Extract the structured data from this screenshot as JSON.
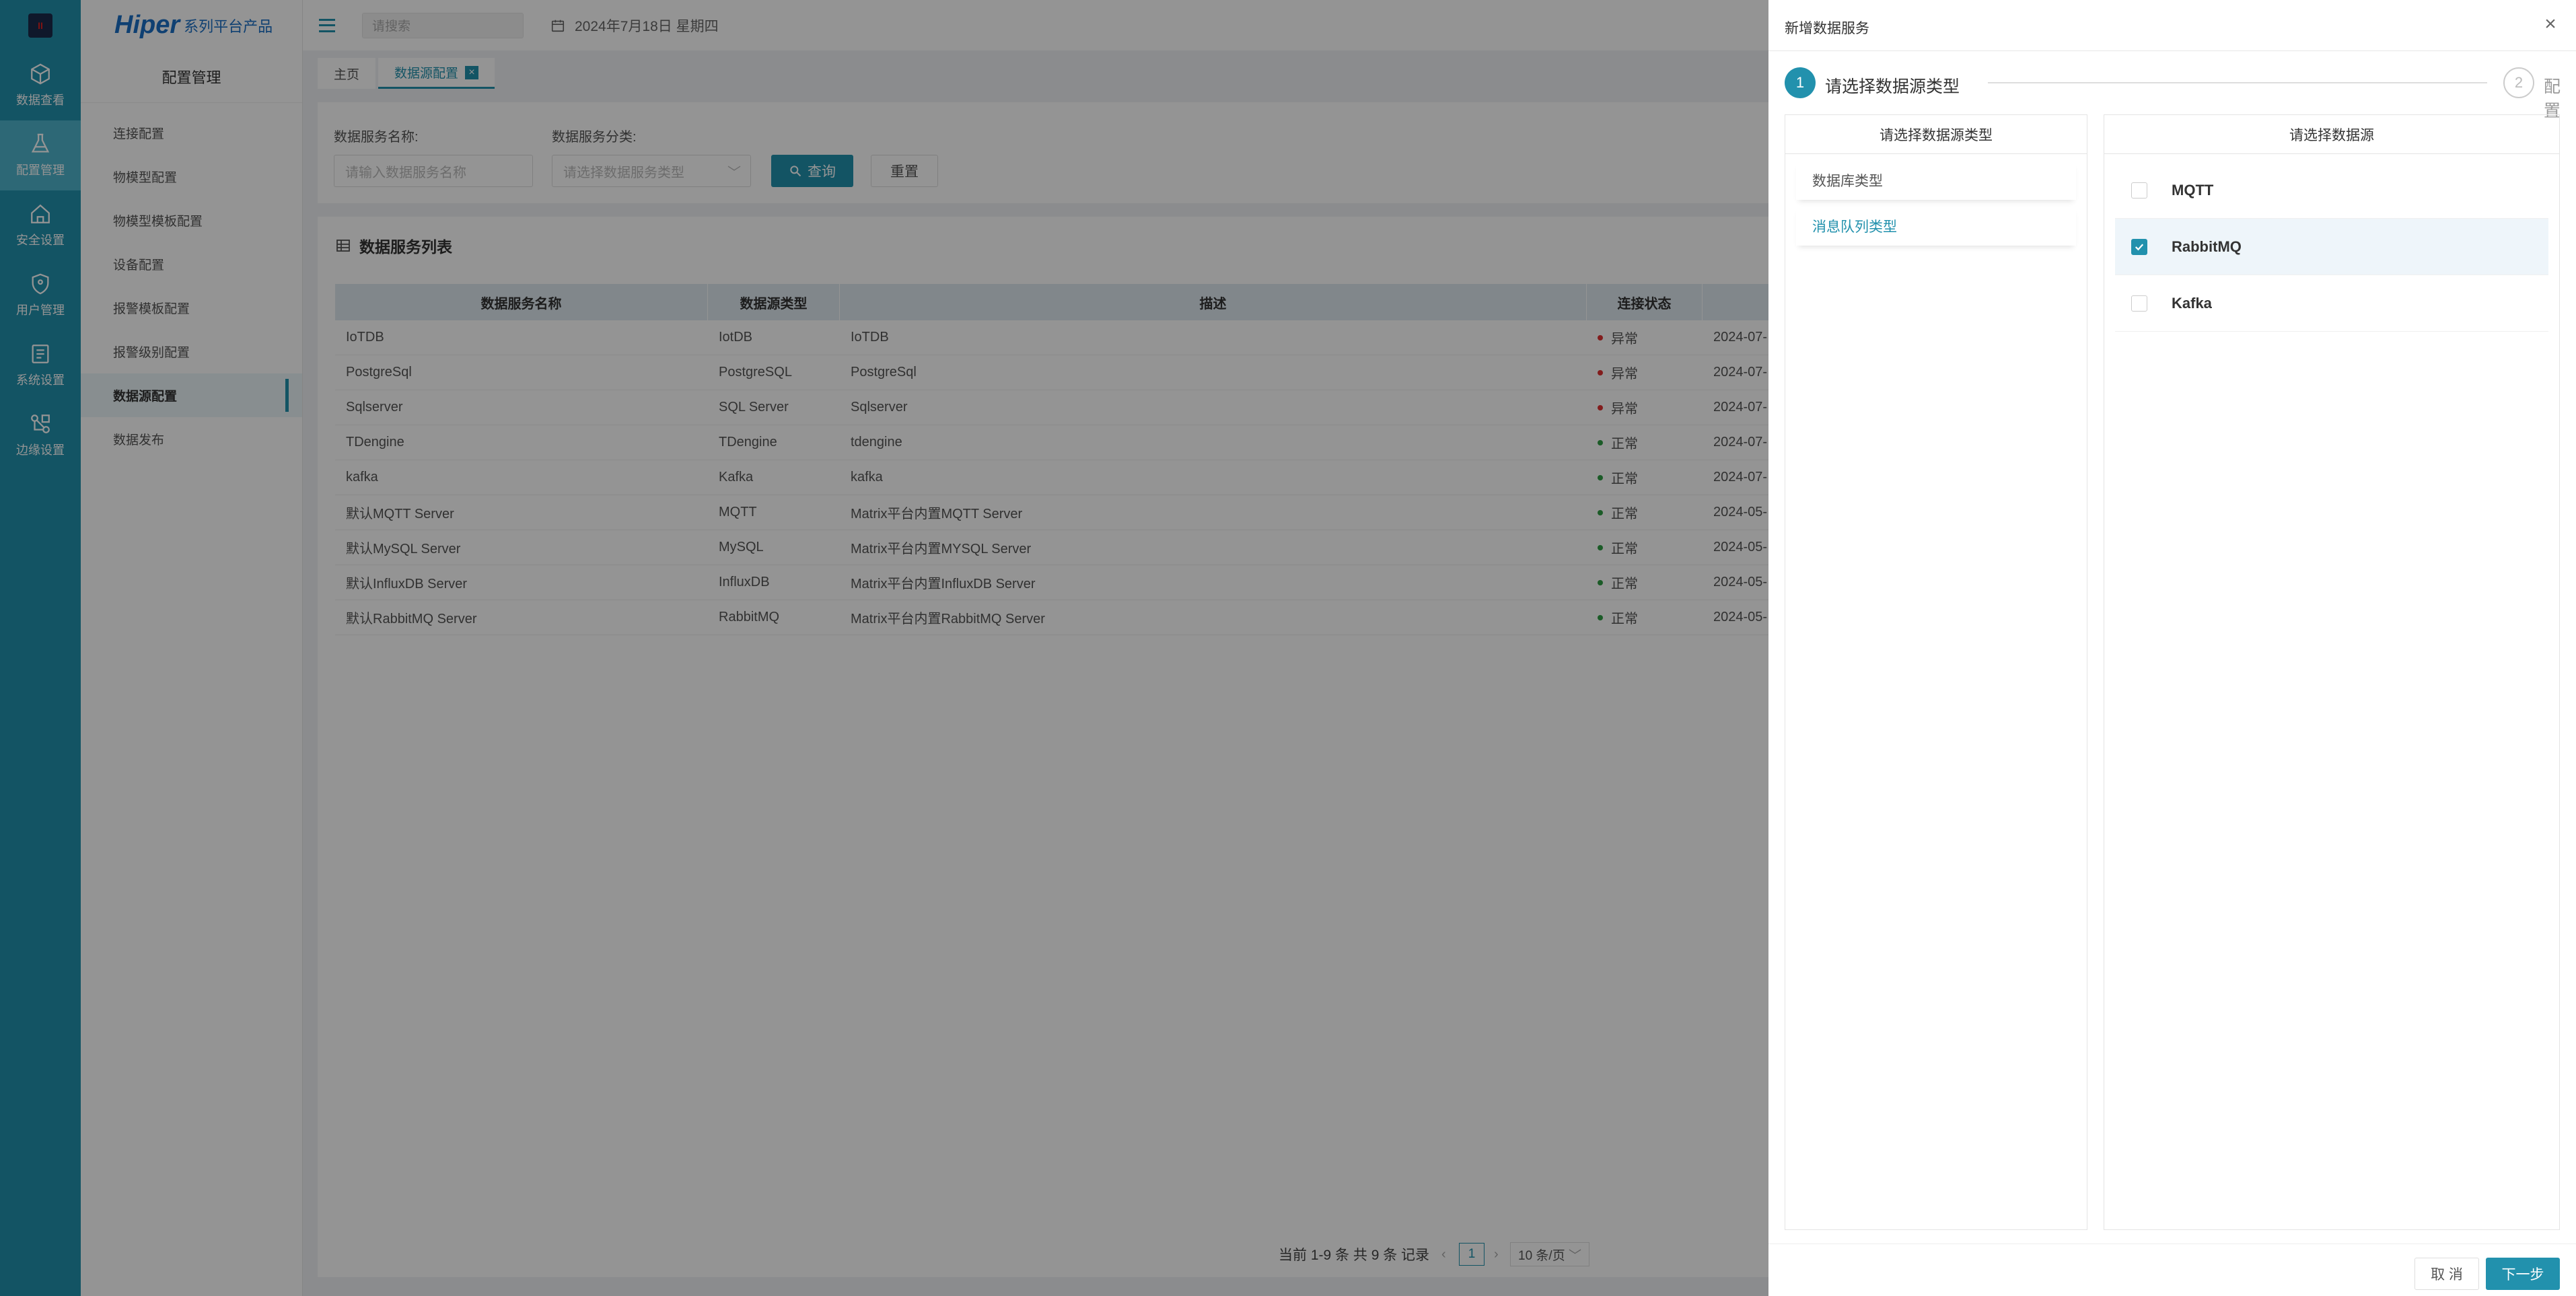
{
  "rail": {
    "items": [
      {
        "label": "数据查看",
        "icon": "cube-icon"
      },
      {
        "label": "配置管理",
        "icon": "flask-icon"
      },
      {
        "label": "安全设置",
        "icon": "home-icon"
      },
      {
        "label": "用户管理",
        "icon": "shield-icon"
      },
      {
        "label": "系统设置",
        "icon": "settings-doc-icon"
      },
      {
        "label": "边缘设置",
        "icon": "edge-network-icon"
      }
    ]
  },
  "brand": {
    "name": "Hiper",
    "tagline": "系列平台产品"
  },
  "menu": {
    "title": "配置管理",
    "items": [
      {
        "label": "连接配置"
      },
      {
        "label": "物模型配置"
      },
      {
        "label": "物模型模板配置"
      },
      {
        "label": "设备配置"
      },
      {
        "label": "报警模板配置"
      },
      {
        "label": "报警级别配置"
      },
      {
        "label": "数据源配置"
      },
      {
        "label": "数据发布"
      }
    ]
  },
  "topbar": {
    "search_placeholder": "请搜索",
    "date": "2024年7月18日 星期四"
  },
  "tabs": [
    {
      "label": "主页"
    },
    {
      "label": "数据源配置"
    }
  ],
  "filter": {
    "name_label": "数据服务名称:",
    "name_placeholder": "请输入数据服务名称",
    "type_label": "数据服务分类:",
    "type_placeholder": "请选择数据服务类型",
    "query_label": "查询",
    "reset_label": "重置"
  },
  "list": {
    "title": "数据服务列表",
    "columns": [
      "数据服务名称",
      "数据源类型",
      "描述",
      "连接状态"
    ],
    "rows": [
      {
        "name": "IoTDB",
        "type": "IotDB",
        "desc": "IoTDB",
        "status": "异常",
        "status_color": "#e03131",
        "time": "2024-07-"
      },
      {
        "name": "PostgreSql",
        "type": "PostgreSQL",
        "desc": "PostgreSql",
        "status": "异常",
        "status_color": "#e03131",
        "time": "2024-07-"
      },
      {
        "name": "Sqlserver",
        "type": "SQL Server",
        "desc": "Sqlserver",
        "status": "异常",
        "status_color": "#e03131",
        "time": "2024-07-"
      },
      {
        "name": "TDengine",
        "type": "TDengine",
        "desc": "tdengine",
        "status": "正常",
        "status_color": "#2f9e44",
        "time": "2024-07-"
      },
      {
        "name": "kafka",
        "type": "Kafka",
        "desc": "kafka",
        "status": "正常",
        "status_color": "#2f9e44",
        "time": "2024-07-"
      },
      {
        "name": "默认MQTT Server",
        "type": "MQTT",
        "desc": "Matrix平台内置MQTT Server",
        "status": "正常",
        "status_color": "#2f9e44",
        "time": "2024-05-"
      },
      {
        "name": "默认MySQL Server",
        "type": "MySQL",
        "desc": "Matrix平台内置MYSQL Server",
        "status": "正常",
        "status_color": "#2f9e44",
        "time": "2024-05-"
      },
      {
        "name": "默认InfluxDB Server",
        "type": "InfluxDB",
        "desc": "Matrix平台内置InfluxDB Server",
        "status": "正常",
        "status_color": "#2f9e44",
        "time": "2024-05-"
      },
      {
        "name": "默认RabbitMQ Server",
        "type": "RabbitMQ",
        "desc": "Matrix平台内置RabbitMQ Server",
        "status": "正常",
        "status_color": "#2f9e44",
        "time": "2024-05-"
      }
    ]
  },
  "pagination": {
    "info": "当前 1-9 条 共 9 条 记录",
    "current_page": "1",
    "page_size": "10 条/页"
  },
  "drawer": {
    "title": "新增数据服务",
    "steps": [
      {
        "number": "1",
        "label": "请选择数据源类型"
      },
      {
        "number": "2",
        "label": "配置"
      }
    ],
    "left_header": "请选择数据源类型",
    "types": [
      {
        "label": "数据库类型"
      },
      {
        "label": "消息队列类型"
      }
    ],
    "right_header": "请选择数据源",
    "sources": [
      {
        "label": "MQTT",
        "checked": false
      },
      {
        "label": "RabbitMQ",
        "checked": true
      },
      {
        "label": "Kafka",
        "checked": false
      }
    ],
    "cancel_label": "取 消",
    "next_label": "下一步"
  },
  "colors": {
    "accent": "#2291ad",
    "error": "#e03131",
    "ok": "#2f9e44"
  }
}
